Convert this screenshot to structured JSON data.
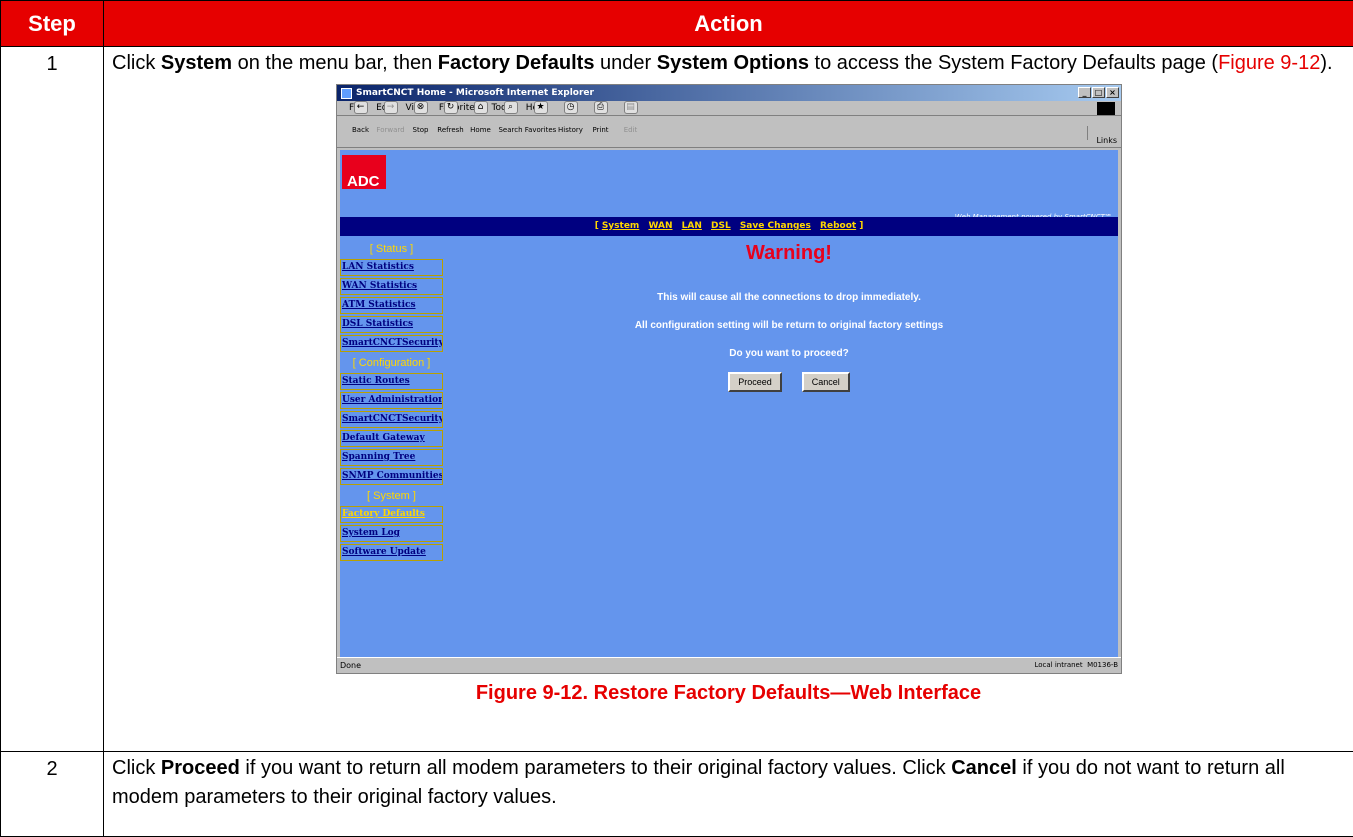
{
  "headers": {
    "step": "Step",
    "action": "Action"
  },
  "step1": {
    "number": "1",
    "text_parts": [
      "Click ",
      "System",
      " on the menu bar, then ",
      "Factory Defaults",
      " under ",
      "System Options",
      " to access the System Factory Defaults page (",
      "Figure 9-12",
      ")."
    ]
  },
  "screenshot": {
    "window_title": "SmartCNCT Home - Microsoft Internet Explorer",
    "menu": [
      "File",
      "Edit",
      "View",
      "Favorites",
      "Tools",
      "Help"
    ],
    "toolbar": [
      "Back",
      "Forward",
      "Stop",
      "Refresh",
      "Home",
      "Search",
      "Favorites",
      "History",
      "Print",
      "Edit"
    ],
    "links_label": "Links",
    "brand": "ADC",
    "powered_by": "Web Management powered by SmartCNCT℠",
    "nav": [
      "System",
      "WAN",
      "LAN",
      "DSL",
      "Save Changes",
      "Reboot"
    ],
    "sections": {
      "status": "[ Status ]",
      "configuration": "[ Configuration ]",
      "system": "[ System ]"
    },
    "status_links": [
      "LAN Statistics",
      "WAN Statistics",
      "ATM Statistics",
      "DSL Statistics",
      "SmartCNCTSecurity"
    ],
    "config_links": [
      "Static Routes",
      "User Administration",
      "SmartCNCTSecurity",
      "Default Gateway",
      "Spanning Tree",
      "SNMP Communities"
    ],
    "system_links": [
      "Factory Defaults",
      "System Log",
      "Software Update"
    ],
    "warning_title": "Warning!",
    "warning_line1": "This will cause all the connections to drop immediately.",
    "warning_line2": "All configuration setting will be return to original factory settings",
    "warning_line3": "Do you want to proceed?",
    "proceed_label": "Proceed",
    "cancel_label": "Cancel",
    "status_text": "Done",
    "zone_text": "Local intranet",
    "image_id": "M0136-B"
  },
  "caption": "Figure 9-12. Restore Factory Defaults—Web Interface",
  "step2": {
    "number": "2",
    "text_parts": [
      "Click ",
      "Proceed",
      " if you want to return all modem parameters to their original factory values. Click ",
      "Cancel",
      " if you do not want to return all modem parameters to their original factory values."
    ]
  },
  "colors": {
    "header_red": "#e60000",
    "page_blue": "#6495ed",
    "nav_navy": "#000080",
    "gold": "#ffd700"
  }
}
